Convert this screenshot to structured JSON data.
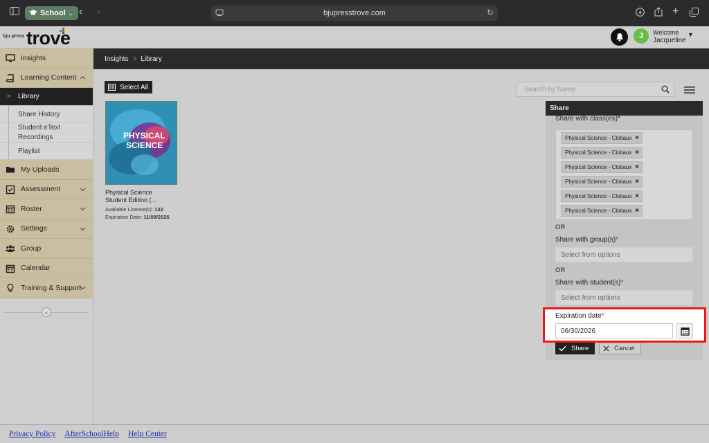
{
  "browser": {
    "profile_label": "School",
    "url": "bjupresstrove.com"
  },
  "header": {
    "logo_small": "bju press",
    "logo_main": "trove",
    "welcome": "Welcome",
    "username": "Jacqueline",
    "avatar_initial": "J"
  },
  "sidebar": {
    "items": [
      {
        "label": "Insights",
        "icon": "monitor-icon"
      },
      {
        "label": "Learning Content",
        "icon": "book-icon"
      },
      {
        "label": "My Uploads",
        "icon": "folder-icon"
      },
      {
        "label": "Assessment",
        "icon": "checkbox-icon"
      },
      {
        "label": "Roster",
        "icon": "calendar-grid-icon"
      },
      {
        "label": "Settings",
        "icon": "gear-icon"
      },
      {
        "label": "Group",
        "icon": "users-icon"
      },
      {
        "label": "Calendar",
        "icon": "calendar-icon"
      },
      {
        "label": "Training & Support",
        "icon": "lightbulb-icon"
      }
    ],
    "subitems": [
      {
        "label": "Library",
        "active": true
      },
      {
        "label": "Share History"
      },
      {
        "label": "Student eText Recordings"
      },
      {
        "label": "Playlist"
      }
    ]
  },
  "breadcrumb": {
    "items": [
      "Insights",
      "Library"
    ],
    "separator": ">"
  },
  "toolbar": {
    "select_all_label": "Select All",
    "search_placeholder": "Search by Name"
  },
  "book": {
    "cover_line1": "PHYSICAL",
    "cover_line2": "SCIENCE",
    "title": "Physical Science Student Edition (...",
    "licenses_label": "Available License(s):",
    "licenses_value": "132",
    "expiration_label": "Expiration Date:",
    "expiration_value": "11/09/2026"
  },
  "share": {
    "title": "Share",
    "share_with_classes_label": "Share with class(es)*",
    "classes": [
      "Physical Science - Clotiaux",
      "Physical Science - Clotiaux",
      "Physical Science - Clotiaux",
      "Physical Science - Clotiaux",
      "Physical Science - Clotiaux",
      "Physical Science - Clotiaux"
    ],
    "remove_glyph": "×",
    "or_label": "OR",
    "groups_label": "Share with group(s)",
    "students_label": "Share with student(s)",
    "required_mark": "*",
    "select_placeholder": "Select from options",
    "expiration_label": "Expiration date",
    "expiration_value": "06/30/2026",
    "share_button": "Share",
    "cancel_button": "Cancel",
    "highlight_color": "#e8191c"
  },
  "footer": {
    "links": [
      "Privacy Policy",
      "AfterSchoolHelp",
      "Help Center"
    ]
  }
}
